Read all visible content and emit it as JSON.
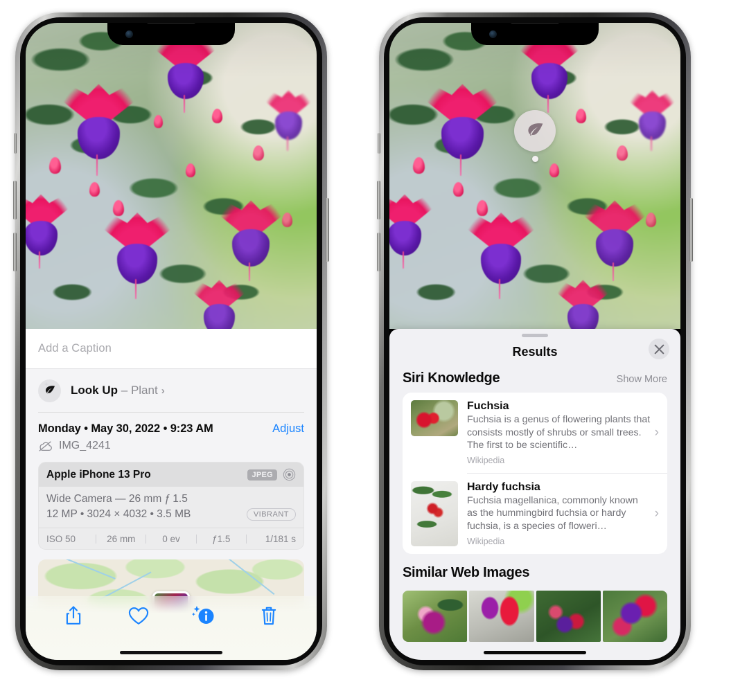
{
  "left_phone": {
    "photo": {
      "alt": "fuchsia-flowers-photo"
    },
    "caption": {
      "placeholder": "Add a Caption",
      "value": ""
    },
    "look_up": {
      "icon": "leaf-icon",
      "sparkle_icon": "sparkles-icon",
      "label": "Look Up",
      "dash": "–",
      "subject": "Plant",
      "chevron": "›"
    },
    "date_row": {
      "date": "Monday • May 30, 2022 • 9:23 AM",
      "adjust_label": "Adjust"
    },
    "file_row": {
      "icon": "cloud-slash-icon",
      "filename": "IMG_4241"
    },
    "metadata": {
      "device": "Apple iPhone 13 Pro",
      "format_badge": "JPEG",
      "aperture_icon": "aperture-icon",
      "lens_line": "Wide Camera — 26 mm ƒ 1.5",
      "size_line": "12 MP • 3024 × 4032 • 3.5 MB",
      "style_badge": "VIBRANT",
      "exif": [
        "ISO 50",
        "26 mm",
        "0 ev",
        "ƒ1.5",
        "1/181 s"
      ]
    },
    "map": {
      "label": "photo-location-map"
    },
    "toolbar": [
      {
        "name": "share-icon",
        "label": "Share"
      },
      {
        "name": "heart-icon",
        "label": "Favorite"
      },
      {
        "name": "info-sparkle-icon",
        "label": "Info"
      },
      {
        "name": "trash-icon",
        "label": "Delete"
      }
    ]
  },
  "right_phone": {
    "photo": {
      "alt": "fuchsia-flowers-photo"
    },
    "lookup_badge": {
      "icon": "leaf-icon",
      "label": "visual-look-up-badge"
    },
    "sheet": {
      "grabber": "drag-handle",
      "title": "Results",
      "close_icon": "close-icon"
    },
    "siri_knowledge": {
      "title": "Siri Knowledge",
      "show_more": "Show More",
      "items": [
        {
          "title": "Fuchsia",
          "description": "Fuchsia is a genus of flowering plants that consists mostly of shrubs or small trees. The first to be scientific…",
          "source": "Wikipedia",
          "chevron": "›",
          "thumb": "fuchsia-thumbnail"
        },
        {
          "title": "Hardy fuchsia",
          "description": "Fuchsia magellanica, commonly known as the hummingbird fuchsia or hardy fuchsia, is a species of floweri…",
          "source": "Wikipedia",
          "chevron": "›",
          "thumb": "hardy-fuchsia-thumbnail"
        }
      ]
    },
    "similar_web_images": {
      "title": "Similar Web Images",
      "items": [
        "web-image-1",
        "web-image-2",
        "web-image-3",
        "web-image-4"
      ]
    }
  },
  "colors": {
    "accent_blue": "#1a84ff",
    "sheet_bg": "#f1f1f4",
    "card_bg": "#ffffff",
    "muted_text": "#737379",
    "title_text": "#0b0b0b"
  }
}
